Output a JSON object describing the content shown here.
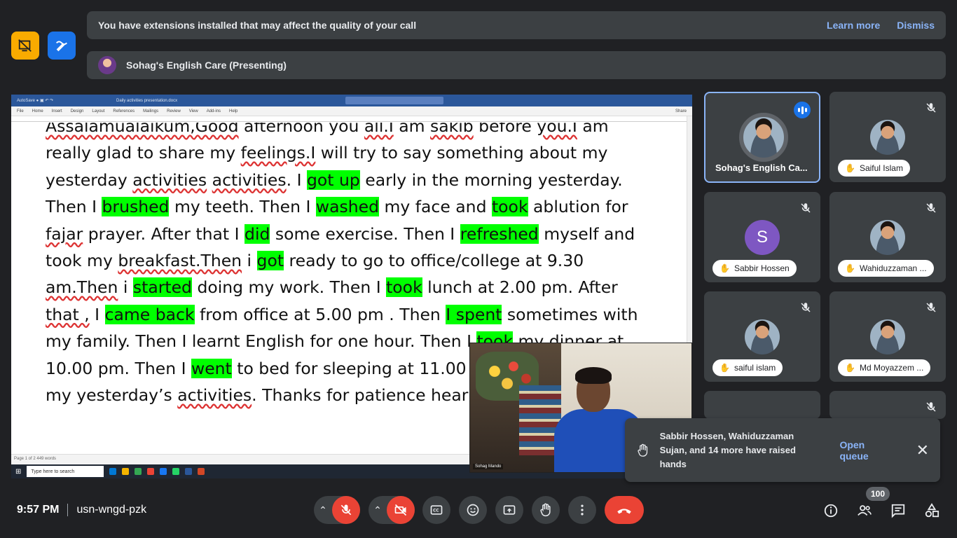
{
  "side_buttons": {
    "left_icon": "presentation-off-icon",
    "right_icon": "whiteboard-pen-icon",
    "left_color": "#f9ab00",
    "right_color": "#1a73e8"
  },
  "banner": {
    "message": "You have extensions installed that may affect the quality of your call",
    "learn_more": "Learn more",
    "dismiss": "Dismiss"
  },
  "presenting": {
    "label": "Sohag's English Care (Presenting)"
  },
  "document": {
    "lines": [
      "Assalamualaikum,Good afternoon you all.I am sakib before you.I am",
      "really glad to share my feelings.I will try to say something about my",
      "yesterday activities activities. I got up early in the morning yesterday.",
      "Then I brushed my teeth. Then I washed my face and took ablution for",
      "fajar prayer. After that I did some exercise. Then I refreshed myself and",
      "took my breakfast.Then i got ready to go to office/college at 9.30",
      "am.Then i started doing my work. Then I took lunch at 2.00 pm. After",
      "that , I came back from office at 5.00 pm . Then I spent sometimes with",
      "my family. Then I learnt English for one hour. Then I took my dinner at",
      "10.00 pm. Then I went to bed for sleeping at 11.00",
      "my yesterday’s activities. Thanks for patience heari"
    ],
    "highlights": [
      "got up",
      "brushed",
      "washed",
      "took",
      "did",
      "refreshed",
      "got",
      "started",
      "took",
      "came back",
      "I spent",
      "took",
      "went"
    ],
    "highlight_color": "#00ff00",
    "word_menu": [
      "File",
      "Home",
      "Insert",
      "Design",
      "Layout",
      "References",
      "Mailings",
      "Review",
      "View",
      "Add-ins",
      "Help"
    ],
    "word_share": "Share",
    "word_title": "Daily activities presentation.docx",
    "status": "Page 1 of 2    449 words",
    "taskbar_search": "Type here to search"
  },
  "presenter_cam": {
    "name": "Sohag Mando"
  },
  "participants": [
    {
      "name": "Sohag's English Ca...",
      "active": true,
      "speaking": true
    },
    {
      "name": "Saiful Islam",
      "muted": true
    },
    {
      "name": "Sabbir Hossen",
      "muted": true,
      "initial": "S"
    },
    {
      "name": "Wahiduzzaman ...",
      "muted": true
    },
    {
      "name": "saiful islam",
      "muted": true
    },
    {
      "name": "Md Moyazzem ...",
      "muted": true
    }
  ],
  "toast": {
    "text": "Sabbir Hossen, Wahiduzzaman Sujan, and 14 more have raised hands",
    "action": "Open queue"
  },
  "bottom": {
    "time": "9:57 PM",
    "meeting_code": "usn-wngd-pzk",
    "people_count": "100"
  }
}
